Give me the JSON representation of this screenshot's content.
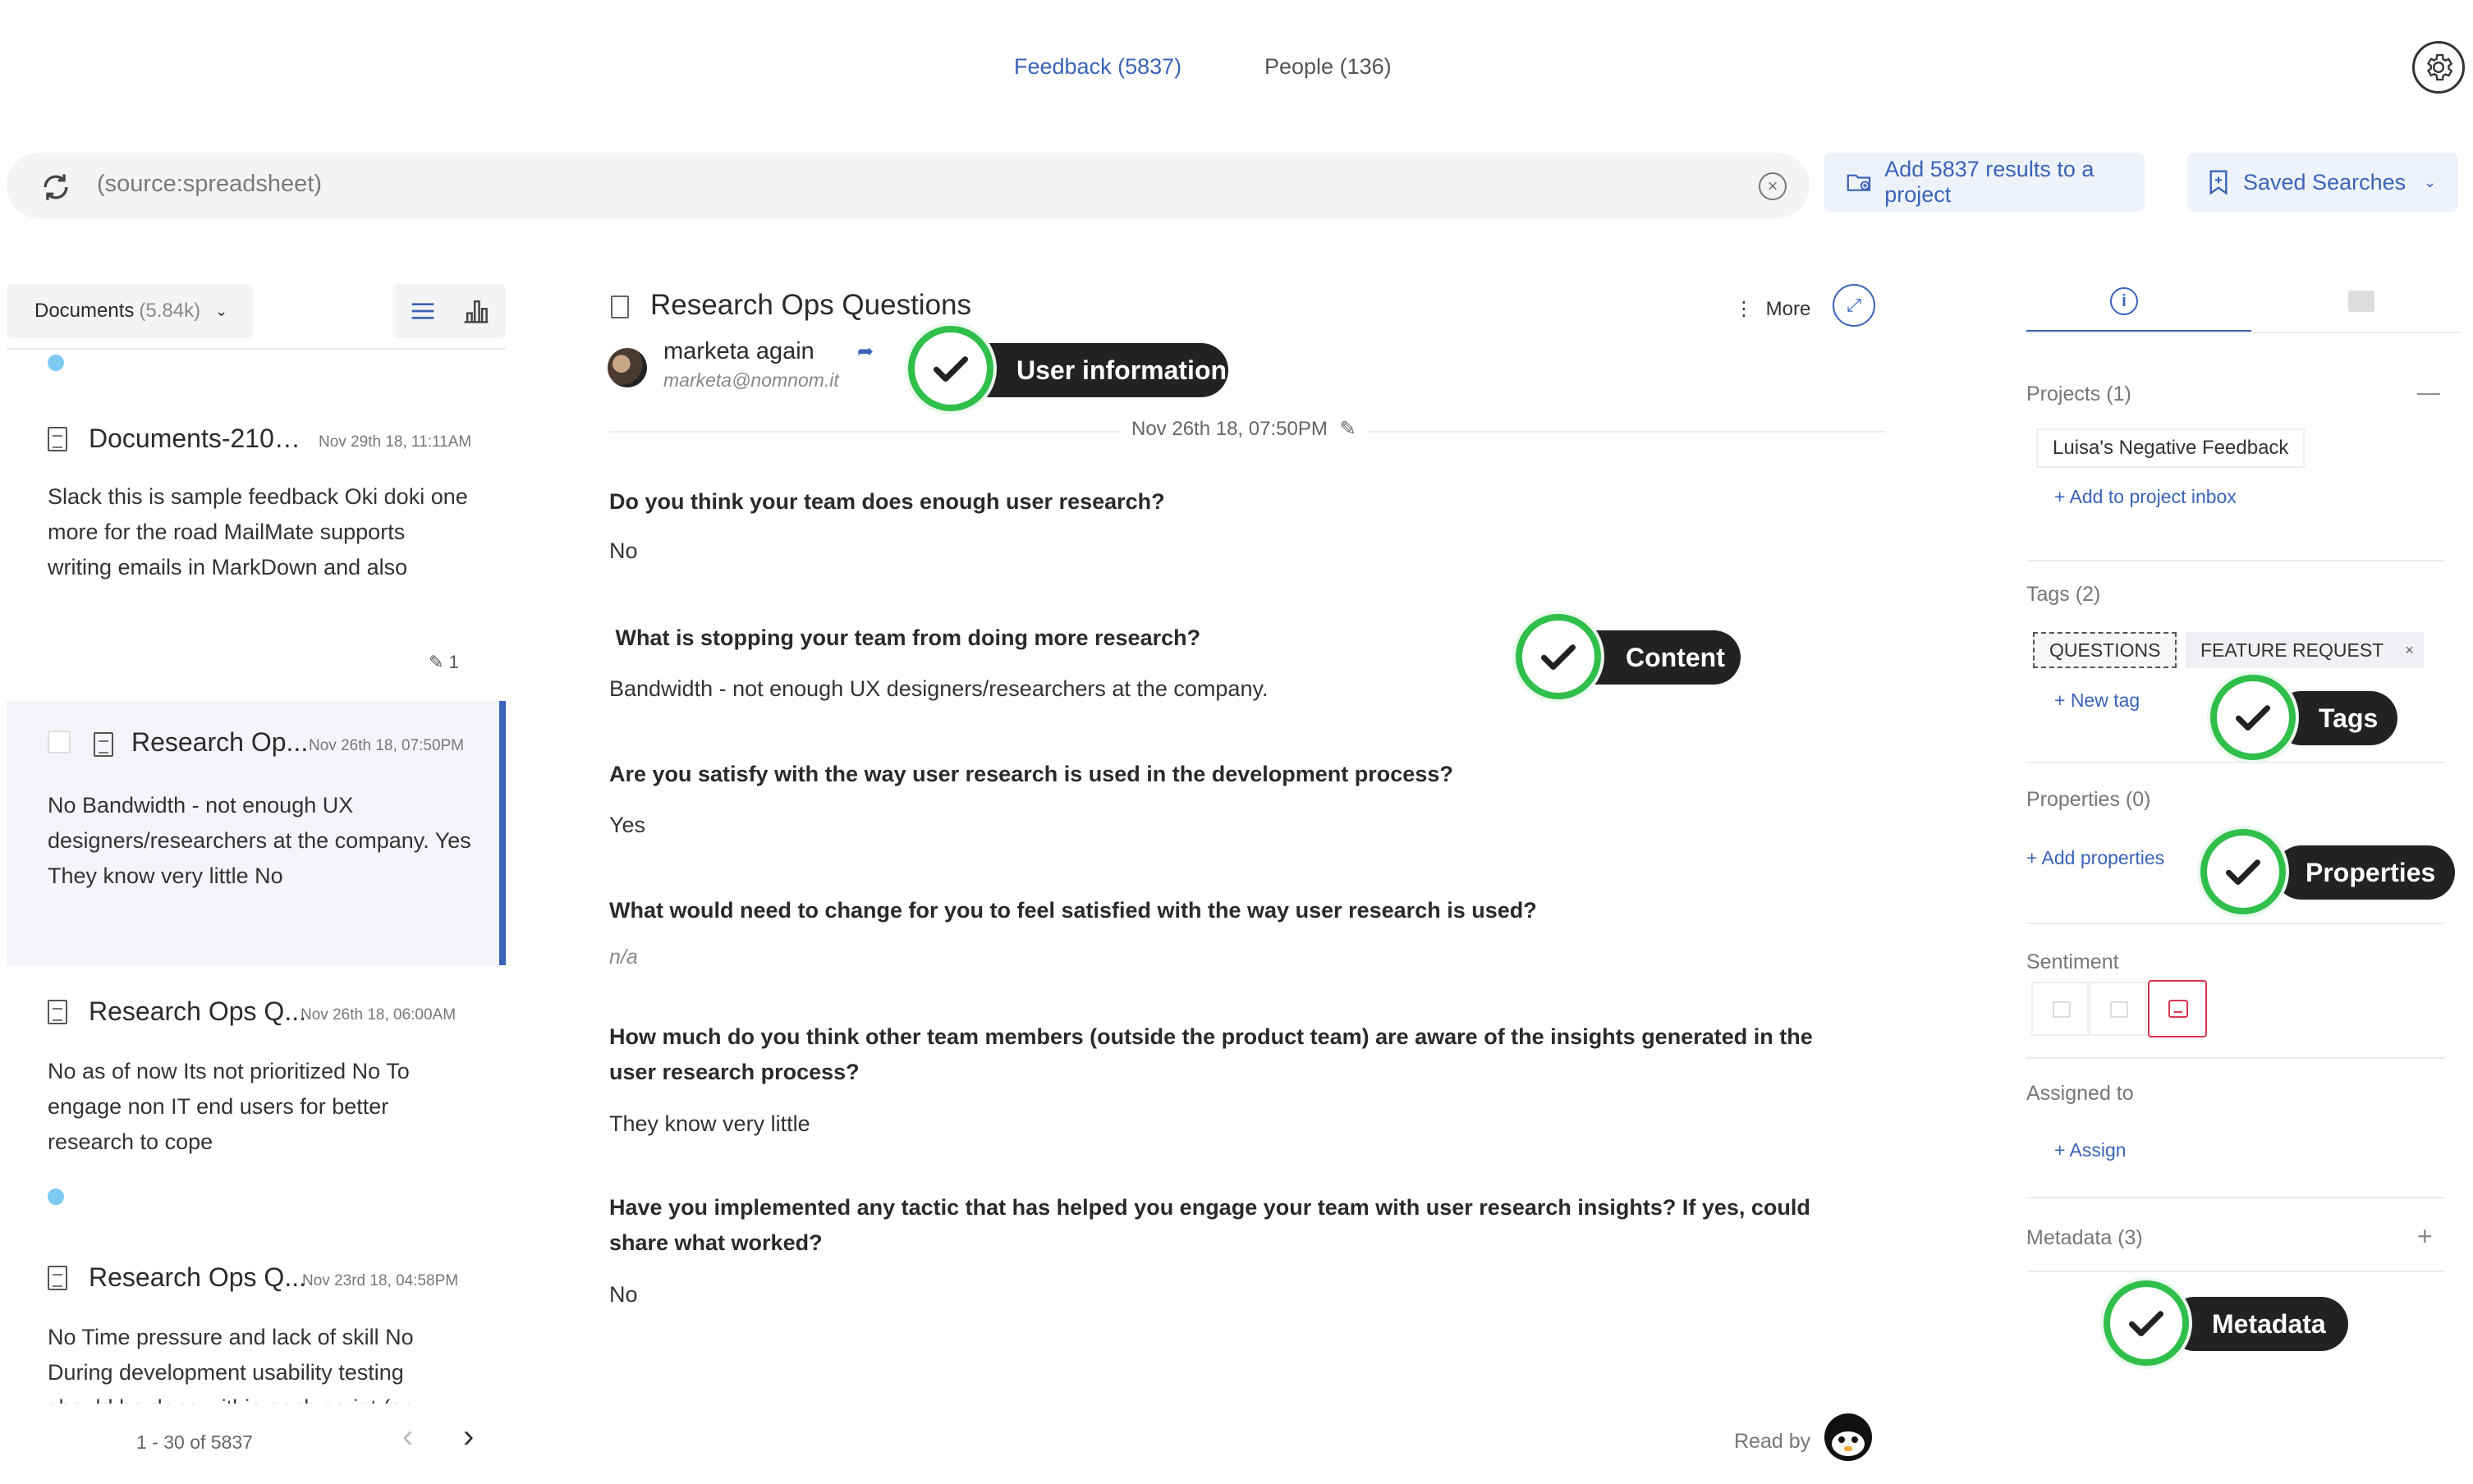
{
  "top_tabs": {
    "feedback": "Feedback (5837)",
    "people": "People (136)"
  },
  "search": {
    "query": "(source:spreadsheet)"
  },
  "actions": {
    "add_results": "Add 5837 results to a project",
    "saved_searches": "Saved Searches"
  },
  "list": {
    "filter_label": "Documents",
    "filter_count": "(5.84k)",
    "cards": [
      {
        "title": "Documents-210e...",
        "date": "Nov 29th 18, 11:11AM",
        "body": "Slack this is sample feedback Oki doki one more for the road MailMate supports writing emails in MarkDown and also",
        "note_count": "1"
      },
      {
        "title": "Research Op...",
        "date": "Nov 26th 18, 07:50PM",
        "body": "No Bandwidth - not enough UX designers/researchers at the company. Yes They know very little No"
      },
      {
        "title": "Research Ops Q...",
        "date": "Nov 26th 18, 06:00AM",
        "body": "No as of now Its not prioritized No To engage non IT end users for better research to cope"
      },
      {
        "title": "Research Ops Q...",
        "date": "Nov 23rd 18, 04:58PM",
        "body": "No Time pressure and lack of skill No During development usability testing should be done within each sprint (or"
      }
    ],
    "pagination": "1 - 30 of 5837"
  },
  "document": {
    "title": "Research Ops Questions",
    "more_label": "More",
    "author_name": "marketa again",
    "author_email": "marketa@nomnom.it",
    "date": "Nov 26th 18, 07:50PM",
    "qa": [
      {
        "q": "Do you think your team does enough user research?",
        "a": "No"
      },
      {
        "q": " What is stopping your team from doing more research?",
        "a": "Bandwidth - not enough UX designers/researchers at the company."
      },
      {
        "q": "Are you satisfy with the way user research is used in the development process?",
        "a": "Yes"
      },
      {
        "q": "What would need to change for you to feel satisfied with the way user research is used?",
        "a": "n/a"
      },
      {
        "q": "How much do you think other team members (outside the product team) are aware of the insights generated in the user research process?",
        "a": "They know very little"
      },
      {
        "q": "Have you implemented any tactic that has helped you engage your team with user research insights? If yes, could share what worked?",
        "a": "No"
      }
    ],
    "read_by": "Read by"
  },
  "annotations": {
    "user_information": "User information",
    "content": "Content",
    "tags": "Tags",
    "properties": "Properties",
    "metadata": "Metadata"
  },
  "sidebar": {
    "projects_label": "Projects (1)",
    "project_name": "Luisa's Negative Feedback",
    "add_to_project": "+ Add to project inbox",
    "tags_label": "Tags (2)",
    "tags": [
      "QUESTIONS",
      "FEATURE REQUEST"
    ],
    "new_tag": "+ New tag",
    "properties_label": "Properties (0)",
    "add_properties": "+ Add properties",
    "sentiment_label": "Sentiment",
    "assigned_label": "Assigned to",
    "assign": "+ Assign",
    "metadata_label": "Metadata (3)"
  },
  "colors": {
    "accent": "#3a63b8",
    "annotation_check": "#2fbf4a",
    "sentiment_negative": "#d9364f"
  }
}
